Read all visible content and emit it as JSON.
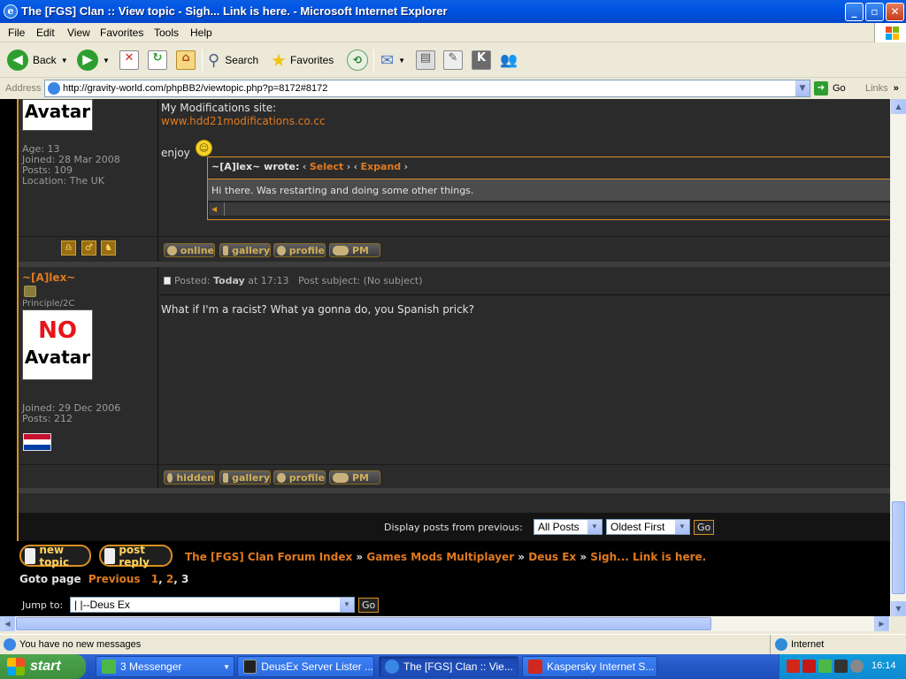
{
  "window": {
    "title": "The [FGS] Clan :: View topic - Sigh... Link is here. - Microsoft Internet Explorer",
    "minimize": "_",
    "maximize": "▫",
    "close": "✕"
  },
  "menu": [
    "File",
    "Edit",
    "View",
    "Favorites",
    "Tools",
    "Help"
  ],
  "toolbar": {
    "back": "Back",
    "search": "Search",
    "favorites": "Favorites"
  },
  "address": {
    "label": "Address",
    "url": "http://gravity-world.com/phpBB2/viewtopic.php?p=8172#8172",
    "go": "Go",
    "links": "Links",
    "links_more": "»"
  },
  "post1": {
    "avatar_text": "Avatar",
    "age": "Age: 13",
    "joined": "Joined: 28 Mar 2008",
    "posts": "Posts: 109",
    "location": "Location: The UK",
    "body_line1": "My Modifications site:",
    "link": "www.hdd21modifications.co.cc",
    "body_line2": "enjoy",
    "quote_author": "~[A]lex~ wrote:",
    "quote_sel_pre": "‹ ",
    "quote_select": "Select",
    "quote_mid": " › ‹ ",
    "quote_expand": "Expand",
    "quote_sel_post": " ›",
    "quote_text": "Hi there. Was restarting and doing some other things.",
    "buttons": [
      "online",
      "gallery",
      "profile",
      "PM"
    ]
  },
  "post2": {
    "username": "~[A]lex~",
    "rank": "Principle/2C",
    "avatar_line1": "NO",
    "avatar_line2": "Avatar",
    "joined": "Joined: 29 Dec 2006",
    "posts": "Posts: 212",
    "posted_label": "Posted: ",
    "posted_day": "Today",
    "posted_time": " at 17:13",
    "subject": "Post subject:  (No subject)",
    "body": "What if I'm a racist? What ya gonna do, you Spanish prick?",
    "buttons": [
      "hidden",
      "gallery",
      "profile",
      "PM"
    ]
  },
  "display": {
    "label": "Display posts from previous:",
    "range": "All Posts",
    "order": "Oldest First",
    "go": "Go"
  },
  "nav": {
    "new_topic": "new topic",
    "post_reply": "post reply",
    "breadcrumb": [
      "The [FGS] Clan Forum Index",
      "Games Mods Multiplayer",
      "Deus Ex",
      "Sigh... Link is here."
    ],
    "separator": "»",
    "goto_label": "Goto page",
    "previous": "Previous",
    "page1": "1",
    "page2": "2",
    "page3": "3",
    "jump_label": "Jump to:",
    "jump_value": "|   |--Deus Ex",
    "jump_go": "Go"
  },
  "status": {
    "message": "You have no new messages",
    "zone": "Internet"
  },
  "taskbar": {
    "start": "start",
    "tasks": [
      "3 Messenger",
      "DeusEx Server Lister ...",
      "The [FGS] Clan :: Vie...",
      "Kaspersky Internet S..."
    ],
    "clock": "16:14"
  },
  "colors": {
    "accent": "#e07a1f",
    "forum_bg": "#2b2b2b",
    "xp_blue": "#0054e3"
  }
}
